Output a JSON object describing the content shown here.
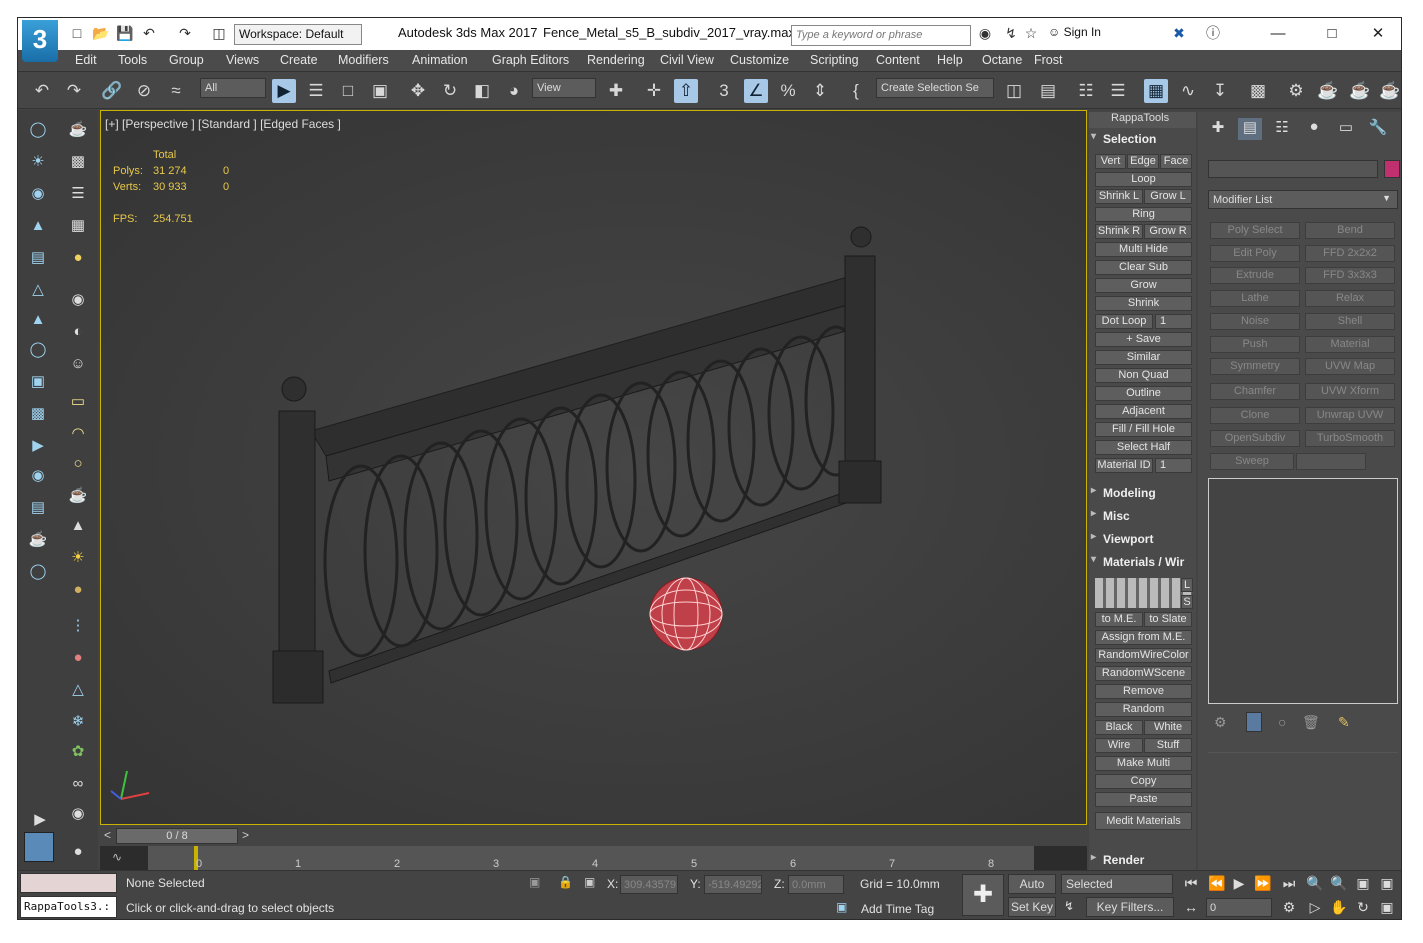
{
  "title_bar": {
    "workspace": "Workspace: Default",
    "app_title": "Autodesk 3ds Max 2017",
    "file_name": "Fence_Metal_s5_B_subdiv_2017_vray.max",
    "search_placeholder": "Type a keyword or phrase",
    "sign_in": "Sign In"
  },
  "menu": [
    "Edit",
    "Tools",
    "Group",
    "Views",
    "Create",
    "Modifiers",
    "Animation",
    "Graph Editors",
    "Rendering",
    "Civil View",
    "Customize",
    "Scripting",
    "Content",
    "Help",
    "Octane",
    "Frost"
  ],
  "toolbar": {
    "filter": "All",
    "ref_coord": "View",
    "named_selection": "Create Selection Se"
  },
  "viewport": {
    "label": "[+] [Perspective ] [Standard ] [Edged Faces ]",
    "stats": {
      "total_label": "Total",
      "polys_label": "Polys:",
      "polys_total": "31 274",
      "polys_sel": "0",
      "verts_label": "Verts:",
      "verts_total": "30 933",
      "verts_sel": "0",
      "fps_label": "FPS:",
      "fps": "254.751"
    }
  },
  "timeline": {
    "frame": "0 / 8",
    "ticks": [
      "0",
      "1",
      "2",
      "3",
      "4",
      "5",
      "6",
      "7",
      "8"
    ]
  },
  "rappatools": {
    "title": "RappaTools",
    "sections": {
      "selection": "Selection",
      "modeling": "Modeling",
      "misc": "Misc",
      "viewport": "Viewport",
      "materials": "Materials / Wir",
      "render": "Render"
    },
    "buttons": {
      "vert": "Vert",
      "edge": "Edge",
      "face": "Face",
      "loop": "Loop",
      "shrink_l": "Shrink L",
      "grow_l": "Grow L",
      "ring": "Ring",
      "shrink_r": "Shrink R",
      "grow_r": "Grow R",
      "multi_hide": "Multi Hide",
      "clear_sub": "Clear Sub",
      "grow": "Grow",
      "shrink": "Shrink",
      "dot_loop": "Dot Loop",
      "dot_loop_val": "1",
      "save": "+ Save",
      "similar": "Similar",
      "non_quad": "Non Quad",
      "outline": "Outline",
      "adjacent": "Adjacent",
      "fill_hole": "Fill / Fill Hole",
      "select_half": "Select Half",
      "material_id": "Material ID",
      "material_id_val": "1",
      "mat_l": "L",
      "mat_s": "S",
      "to_me": "to M.E.",
      "to_slate": "to Slate",
      "assign_me": "Assign from M.E.",
      "random_wire": "RandomWireColor",
      "random_wscene": "RandomWScene",
      "remove": "Remove",
      "random": "Random",
      "black": "Black",
      "white": "White",
      "wire": "Wire",
      "stuff": "Stuff",
      "make_multi": "Make Multi",
      "copy": "Copy",
      "paste": "Paste",
      "medit": "Medit Materials"
    }
  },
  "command_panel": {
    "modifier_list": "Modifier List",
    "color_swatch": "#c0306e",
    "modifiers": [
      "Poly Select",
      "Bend",
      "Edit Poly",
      "FFD 2x2x2",
      "Extrude",
      "FFD 3x3x3",
      "Lathe",
      "Relax",
      "Noise",
      "Shell",
      "Push",
      "Material",
      "Symmetry",
      "UVW Map",
      "Chamfer",
      "UVW Xform",
      "Clone",
      "Unwrap UVW",
      "OpenSubdiv",
      "TurboSmooth",
      "Sweep",
      ""
    ]
  },
  "status": {
    "script_field": "RappaTools3.:",
    "selection": "None Selected",
    "prompt": "Click or click-and-drag to select objects",
    "x_label": "X:",
    "x": "309.43579",
    "y_label": "Y:",
    "y": "-519.49292",
    "z_label": "Z:",
    "z": "0.0mm",
    "grid": "Grid = 10.0mm",
    "add_time_tag": "Add Time Tag",
    "auto_key": "Auto Key",
    "set_key": "Set Key",
    "key_mode": "Selected",
    "key_filters": "Key Filters...",
    "frame_field": "0"
  }
}
